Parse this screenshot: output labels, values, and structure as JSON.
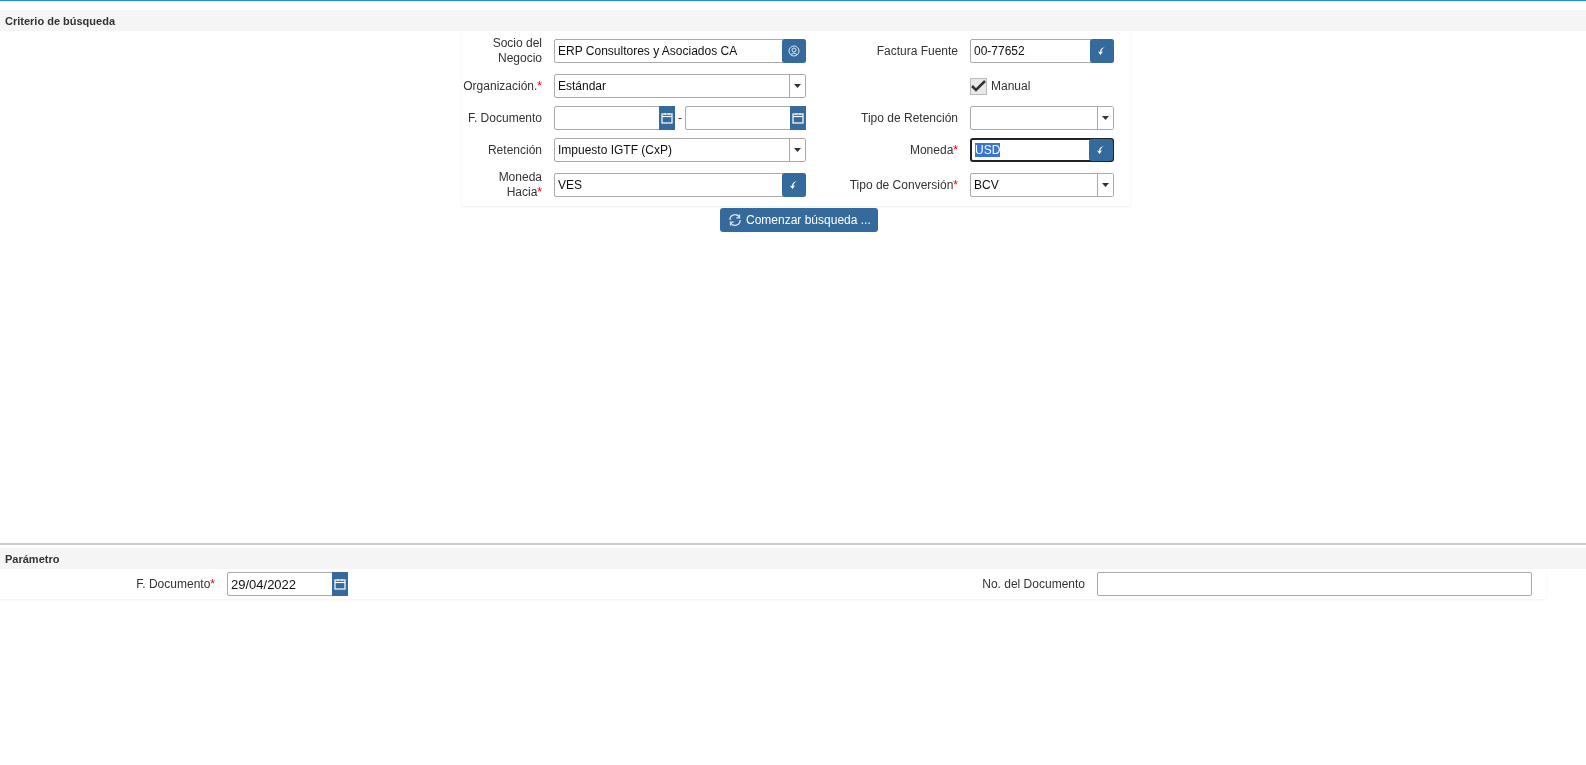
{
  "criteria": {
    "title": "Criterio de búsqueda",
    "rows": [
      {
        "left": {
          "kind": "partner",
          "label": "Socio del Negocio",
          "value": "ERP Consultores y Asociados CA"
        },
        "right": {
          "kind": "lookup",
          "label": "Factura Fuente",
          "value": "00-77652"
        }
      },
      {
        "left": {
          "kind": "combo",
          "label": "Organización.",
          "required_mark": "*",
          "value": "Estándar"
        },
        "right": {
          "kind": "checkbox",
          "label": "Manual",
          "checked": true
        }
      },
      {
        "left": {
          "kind": "daterange",
          "label": "F. Documento",
          "separator": "-"
        },
        "right": {
          "kind": "combo",
          "label": "Tipo de Retención"
        }
      },
      {
        "left": {
          "kind": "combo",
          "label": "Retención",
          "value": "Impuesto IGTF (CxP)"
        },
        "right": {
          "kind": "lookup",
          "label": "Moneda",
          "required_mark": "*",
          "value": "USD",
          "focused": true
        }
      },
      {
        "left": {
          "kind": "lookup",
          "label": "Moneda Hacia",
          "required_mark": "*",
          "value": "VES"
        },
        "right": {
          "kind": "combo",
          "label": "Tipo de Conversión",
          "required_mark": "*",
          "value": "BCV"
        }
      }
    ],
    "search_button": "Comenzar búsqueda ..."
  },
  "parameters": {
    "title": "Parámetro",
    "fields": [
      {
        "kind": "date",
        "label": "F. Documento",
        "required_mark": "*",
        "value": "29/04/2022"
      },
      {
        "kind": "text",
        "label": "No. del Documento"
      }
    ]
  }
}
